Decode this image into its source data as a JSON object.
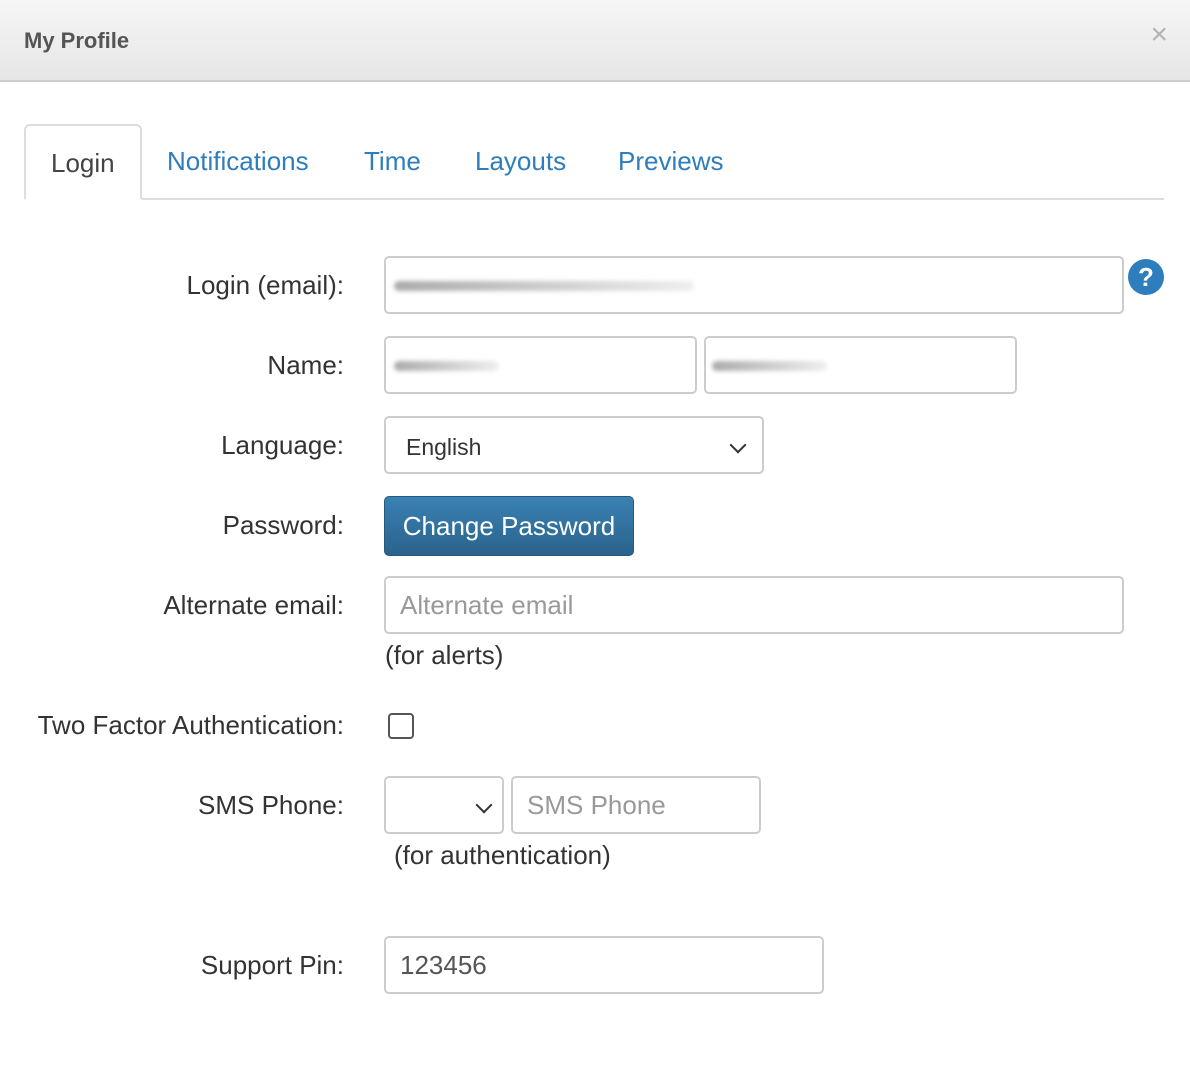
{
  "dialog": {
    "title": "My Profile",
    "close_glyph": "×"
  },
  "tabs": [
    {
      "label": "Login",
      "active": true
    },
    {
      "label": "Notifications",
      "active": false
    },
    {
      "label": "Time",
      "active": false
    },
    {
      "label": "Layouts",
      "active": false
    },
    {
      "label": "Previews",
      "active": false
    }
  ],
  "form": {
    "login_email": {
      "label": "Login (email):",
      "value": "",
      "help_icon": "question-circle-icon",
      "help_glyph": "?"
    },
    "name": {
      "label": "Name:",
      "first_value": "",
      "last_value": ""
    },
    "language": {
      "label": "Language:",
      "selected": "English"
    },
    "password": {
      "label": "Password:",
      "button_label": "Change Password"
    },
    "alternate_email": {
      "label": "Alternate email:",
      "placeholder": "Alternate email",
      "value": "",
      "hint": "(for alerts)"
    },
    "two_factor": {
      "label": "Two Factor Authentication:",
      "checked": false
    },
    "sms_phone": {
      "label": "SMS Phone:",
      "country_selected": "",
      "placeholder": "SMS Phone",
      "value": "",
      "hint": "(for authentication)"
    },
    "support_pin": {
      "label": "Support Pin:",
      "value": "123456"
    }
  },
  "colors": {
    "link": "#2e7dbc",
    "primary_button": "#2f6f9e",
    "header_bg": "#eeeeee"
  }
}
